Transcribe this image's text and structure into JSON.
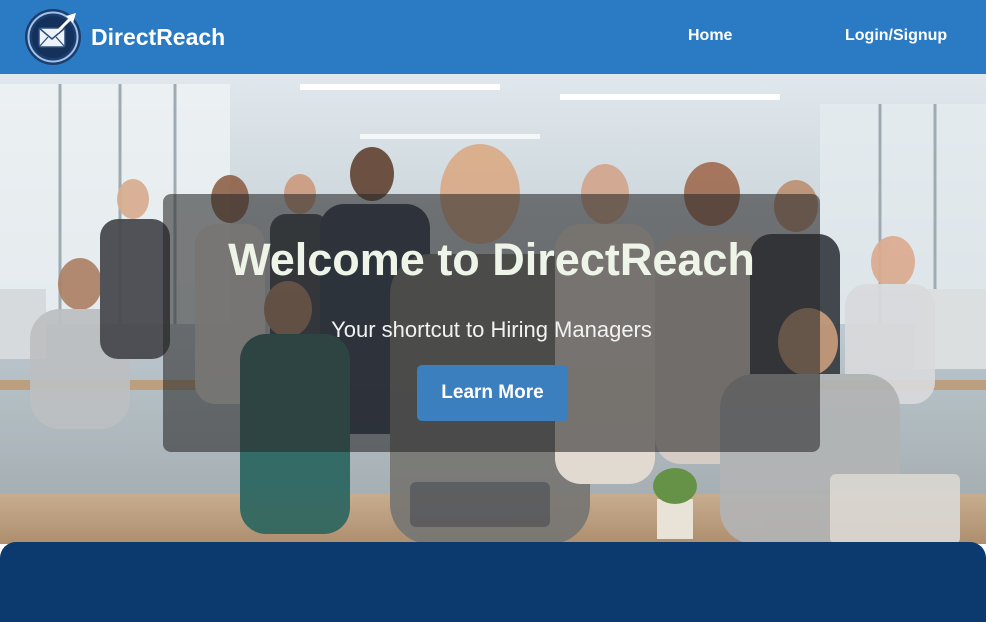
{
  "brand": {
    "name": "DirectReach",
    "logo_icon": "envelope-arrow-logo-icon"
  },
  "nav": {
    "home_label": "Home",
    "login_label": "Login/Signup"
  },
  "hero": {
    "title": "Welcome to DirectReach",
    "subtitle": "Your shortcut to Hiring Managers",
    "cta_label": "Learn More"
  },
  "colors": {
    "navbar": "#2a7bc3",
    "cta": "#3b7fbe",
    "bottom_panel": "#0c3a6e",
    "title_text": "#eef5e8"
  }
}
